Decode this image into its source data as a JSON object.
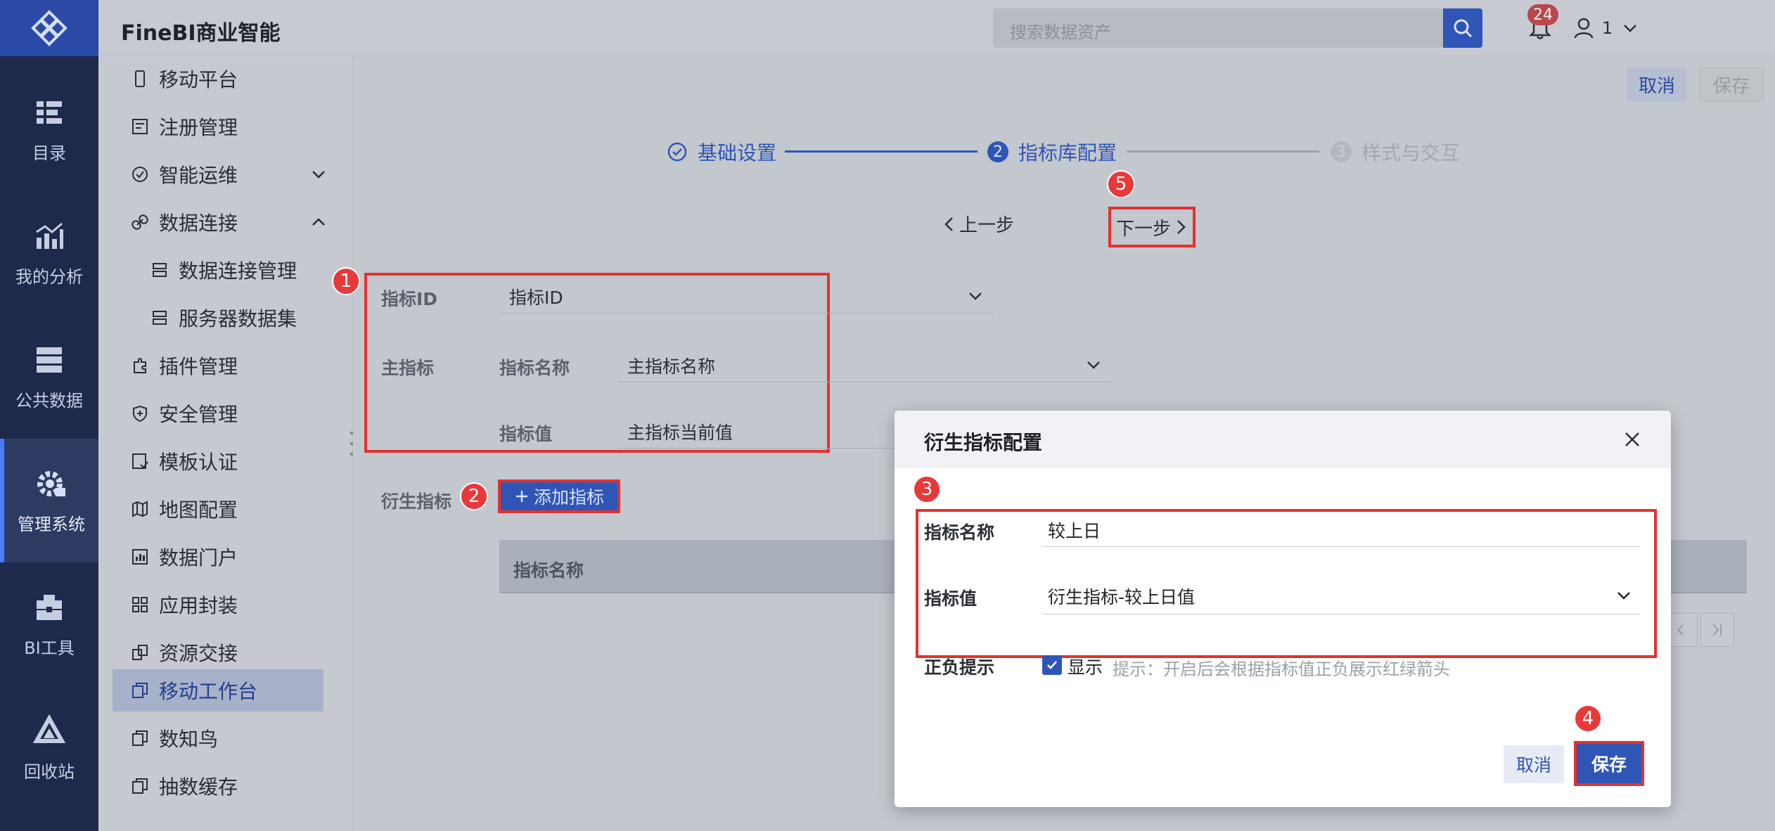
{
  "app": {
    "brand": "FineBI商业智能"
  },
  "topbar": {
    "search_placeholder": "搜索数据资产",
    "notification_count": "24",
    "user": "1"
  },
  "rail": {
    "items": [
      {
        "label": "目录",
        "icon": "catalog-icon"
      },
      {
        "label": "我的分析",
        "icon": "analysis-icon"
      },
      {
        "label": "公共数据",
        "icon": "public-data-icon"
      },
      {
        "label": "管理系统",
        "icon": "gear-icon",
        "active": true
      },
      {
        "label": "BI工具",
        "icon": "toolbox-icon"
      },
      {
        "label": "回收站",
        "icon": "recycle-icon"
      }
    ]
  },
  "menu": {
    "items": [
      {
        "label": "移动平台"
      },
      {
        "label": "注册管理"
      },
      {
        "label": "智能运维"
      },
      {
        "label": "数据连接"
      },
      {
        "label": "数据连接管理"
      },
      {
        "label": "服务器数据集"
      },
      {
        "label": "插件管理"
      },
      {
        "label": "安全管理"
      },
      {
        "label": "模板认证"
      },
      {
        "label": "地图配置"
      },
      {
        "label": "数据门户"
      },
      {
        "label": "应用封装"
      },
      {
        "label": "资源交接"
      },
      {
        "label": "移动工作台",
        "active": true
      },
      {
        "label": "数知鸟"
      },
      {
        "label": "抽数缓存"
      }
    ]
  },
  "header_actions": {
    "cancel": "取消",
    "save": "保存"
  },
  "steps": [
    {
      "label": "基础设置",
      "state": "done"
    },
    {
      "label": "指标库配置",
      "state": "current",
      "index": "2"
    },
    {
      "label": "样式与交互",
      "state": "pending",
      "index": "3"
    }
  ],
  "nav": {
    "prev": "上一步",
    "next": "下一步"
  },
  "markers": [
    "1",
    "2",
    "3",
    "4",
    "5"
  ],
  "form": {
    "id_label": "指标ID",
    "id_value": "指标ID",
    "main_label": "主指标",
    "name_label": "指标名称",
    "name_value": "主指标名称",
    "value_label": "指标值",
    "value_value": "主指标当前值",
    "derived_label": "衍生指标",
    "add_button": "添加指标",
    "table_col": "指标名称"
  },
  "dialog": {
    "title": "衍生指标配置",
    "name_label": "指标名称",
    "name_value": "较上日",
    "value_label": "指标值",
    "value_value": "衍生指标-较上日值",
    "tip_label": "正负提示",
    "show_label": "显示",
    "show_checked": true,
    "hint": "提示：开启后会根据指标值正负展示红绿箭头",
    "cancel": "取消",
    "save": "保存"
  },
  "colors": {
    "accent": "#2f55b6",
    "highlight_red": "#e4312e",
    "rail_bg": "#1e2a4c"
  }
}
